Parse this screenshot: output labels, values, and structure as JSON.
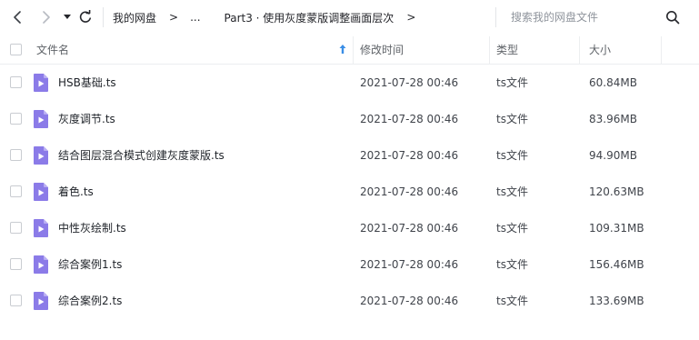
{
  "toolbar": {
    "back": "back-arrow",
    "forward": "forward-arrow",
    "dropdown": "dropdown-caret",
    "refresh": "refresh"
  },
  "breadcrumb": {
    "root": "我的网盘",
    "sep1": ">",
    "ellipsis": "...",
    "current": "Part3 · 使用灰度蒙版调整画面层次",
    "sep2": ">"
  },
  "search": {
    "placeholder": "搜索我的网盘文件"
  },
  "columns": {
    "name": "文件名",
    "mtime": "修改时间",
    "type": "类型",
    "size": "大小"
  },
  "colors": {
    "video_icon": "#8b7be8",
    "video_icon_fold": "#b9aef3",
    "sort_arrow": "#3a8ee6"
  },
  "files": [
    {
      "name": "HSB基础.ts",
      "mtime": "2021-07-28 00:46",
      "type": "ts文件",
      "size": "60.84MB"
    },
    {
      "name": "灰度调节.ts",
      "mtime": "2021-07-28 00:46",
      "type": "ts文件",
      "size": "83.96MB"
    },
    {
      "name": "结合图层混合模式创建灰度蒙版.ts",
      "mtime": "2021-07-28 00:46",
      "type": "ts文件",
      "size": "94.90MB"
    },
    {
      "name": "着色.ts",
      "mtime": "2021-07-28 00:46",
      "type": "ts文件",
      "size": "120.63MB"
    },
    {
      "name": "中性灰绘制.ts",
      "mtime": "2021-07-28 00:46",
      "type": "ts文件",
      "size": "109.31MB"
    },
    {
      "name": "综合案例1.ts",
      "mtime": "2021-07-28 00:46",
      "type": "ts文件",
      "size": "156.46MB"
    },
    {
      "name": "综合案例2.ts",
      "mtime": "2021-07-28 00:46",
      "type": "ts文件",
      "size": "133.69MB"
    }
  ]
}
